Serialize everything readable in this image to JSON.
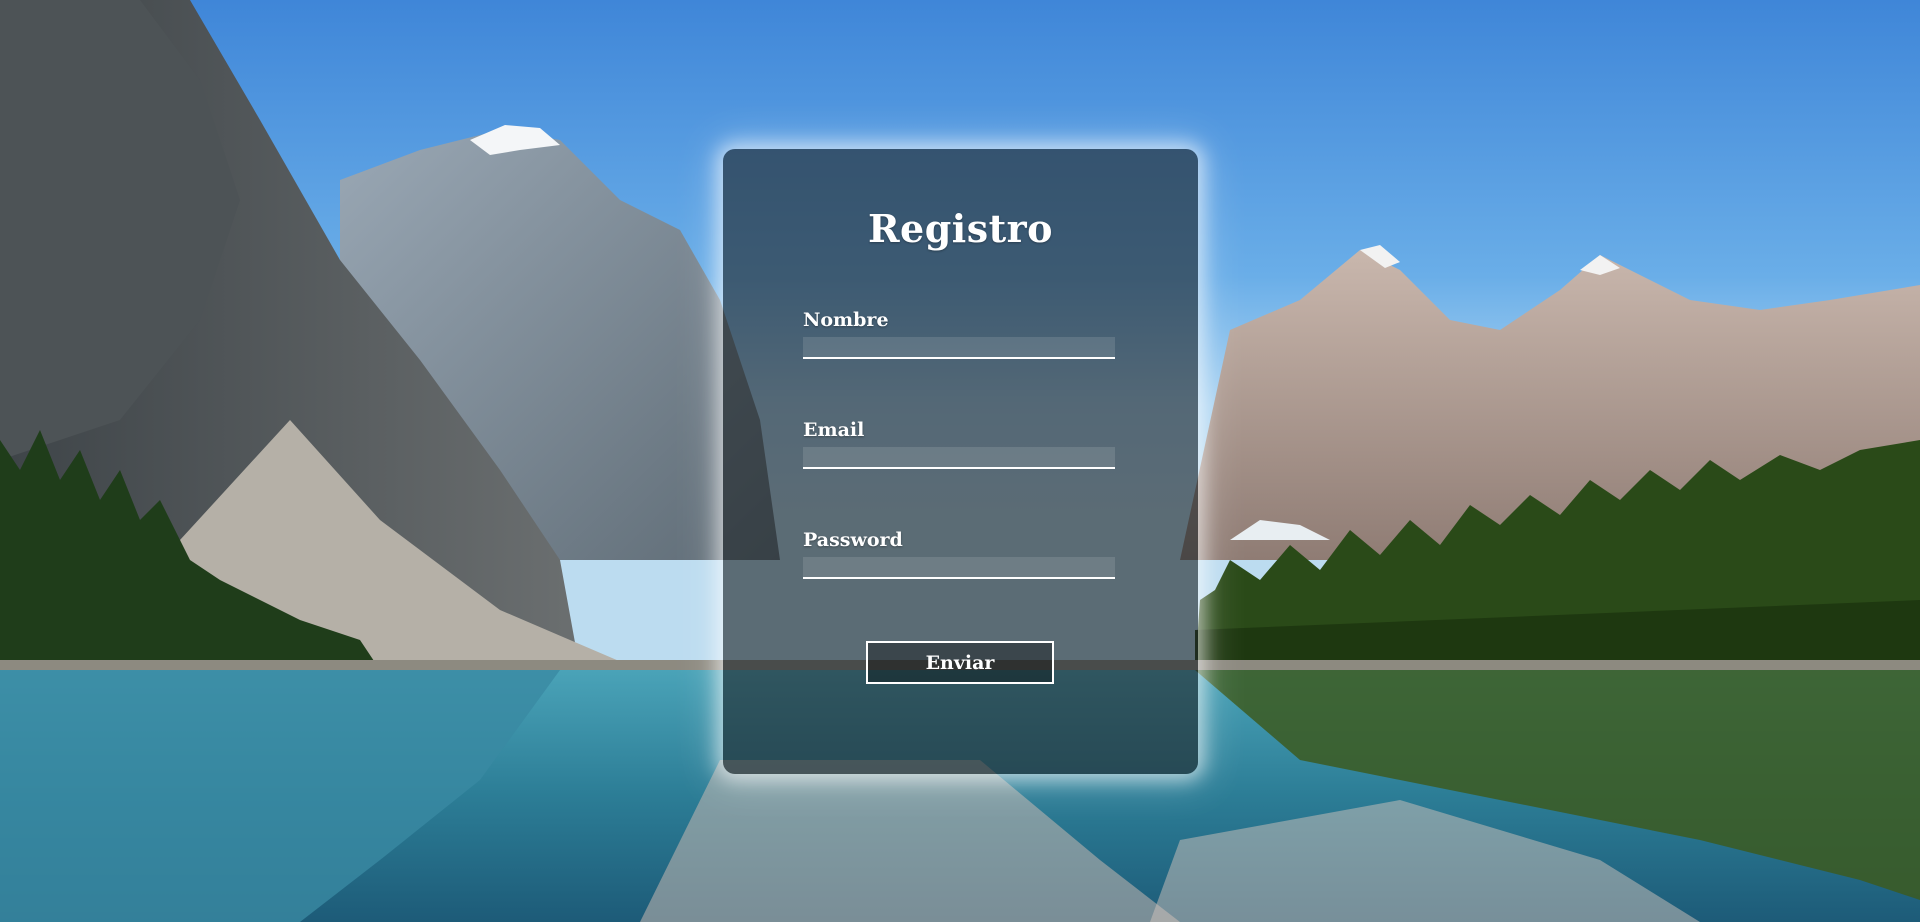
{
  "form": {
    "title": "Registro",
    "fields": [
      {
        "label": "Nombre",
        "value": "",
        "type": "text"
      },
      {
        "label": "Email",
        "value": "",
        "type": "email"
      },
      {
        "label": "Password",
        "value": "",
        "type": "password"
      }
    ],
    "submit_label": "Enviar"
  },
  "colors": {
    "sky_top": "#3f86d8",
    "card_bg": "rgba(32,38,42,0.62)",
    "text": "#ffffff",
    "water": "#2f8fa8",
    "forest": "#1f3a14"
  },
  "background": {
    "description_icon": "mountain-lake-landscape"
  }
}
